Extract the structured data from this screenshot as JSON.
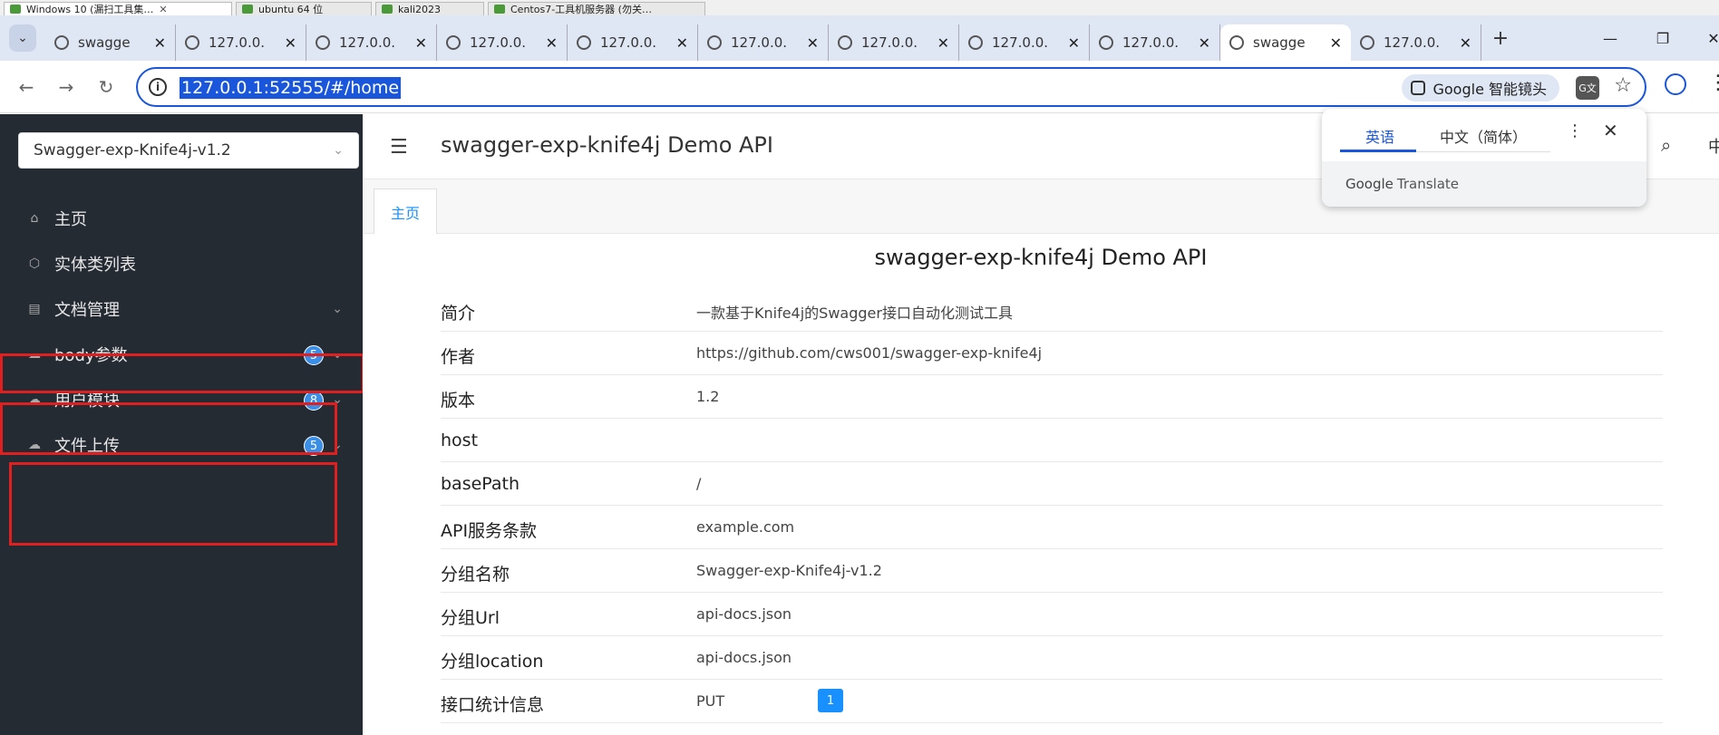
{
  "vm_tabs": [
    {
      "label": "Windows 10 (漏扫工具集…",
      "active": true
    },
    {
      "label": "ubuntu 64 位",
      "active": false
    },
    {
      "label": "kali2023",
      "active": false
    },
    {
      "label": "Centos7-工具机服务器 (勿关…",
      "active": false
    }
  ],
  "browser_tabs": [
    {
      "label": "swagge",
      "active": false
    },
    {
      "label": "127.0.0.",
      "active": false
    },
    {
      "label": "127.0.0.",
      "active": false
    },
    {
      "label": "127.0.0.",
      "active": false
    },
    {
      "label": "127.0.0.",
      "active": false
    },
    {
      "label": "127.0.0.",
      "active": false
    },
    {
      "label": "127.0.0.",
      "active": false
    },
    {
      "label": "127.0.0.",
      "active": false
    },
    {
      "label": "127.0.0.",
      "active": false
    },
    {
      "label": "swagge",
      "active": true
    },
    {
      "label": "127.0.0.",
      "active": false
    }
  ],
  "address": {
    "url": "127.0.0.1:52555/#/home",
    "lens_label": "Google 智能镜头"
  },
  "sidebar": {
    "group_select": "Swagger-exp-Knife4j-v1.2",
    "items": [
      {
        "label": "主页",
        "icon": "home-icon",
        "badge": null,
        "expandable": false
      },
      {
        "label": "实体类列表",
        "icon": "cube-icon",
        "badge": null,
        "expandable": false
      },
      {
        "label": "文档管理",
        "icon": "document-icon",
        "badge": null,
        "expandable": true
      },
      {
        "label": "body参数",
        "icon": "cloud-icon",
        "badge": "5",
        "expandable": true
      },
      {
        "label": "用户模块",
        "icon": "cloud-icon",
        "badge": "8",
        "expandable": true
      },
      {
        "label": "文件上传",
        "icon": "cloud-icon",
        "badge": "5",
        "expandable": true
      }
    ]
  },
  "header": {
    "title": "swagger-exp-knife4j Demo API",
    "lang": "中"
  },
  "home_tab": "主页",
  "content": {
    "title": "swagger-exp-knife4j Demo API",
    "rows": [
      {
        "label": "简介",
        "value": "一款基于Knife4j的Swagger接口自动化测试工具"
      },
      {
        "label": "作者",
        "value": "https://github.com/cws001/swagger-exp-knife4j"
      },
      {
        "label": "版本",
        "value": "1.2"
      },
      {
        "label": "host",
        "value": ""
      },
      {
        "label": "basePath",
        "value": "/"
      },
      {
        "label": "API服务条款",
        "value": "example.com"
      },
      {
        "label": "分组名称",
        "value": "Swagger-exp-Knife4j-v1.2"
      },
      {
        "label": "分组Url",
        "value": "api-docs.json"
      },
      {
        "label": "分组location",
        "value": "api-docs.json"
      },
      {
        "label": "接口统计信息",
        "value": ""
      }
    ],
    "stats": {
      "method": "PUT",
      "count": "1"
    }
  },
  "translate_popup": {
    "tab_english": "英语",
    "tab_chinese": "中文（简体）",
    "footer_google": "Google",
    "footer_translate": "Translate"
  },
  "colors": {
    "accent": "#1890ff",
    "sidebar_bg": "#252b33",
    "highlight": "#e02020",
    "chrome_blue": "#1a56db"
  }
}
